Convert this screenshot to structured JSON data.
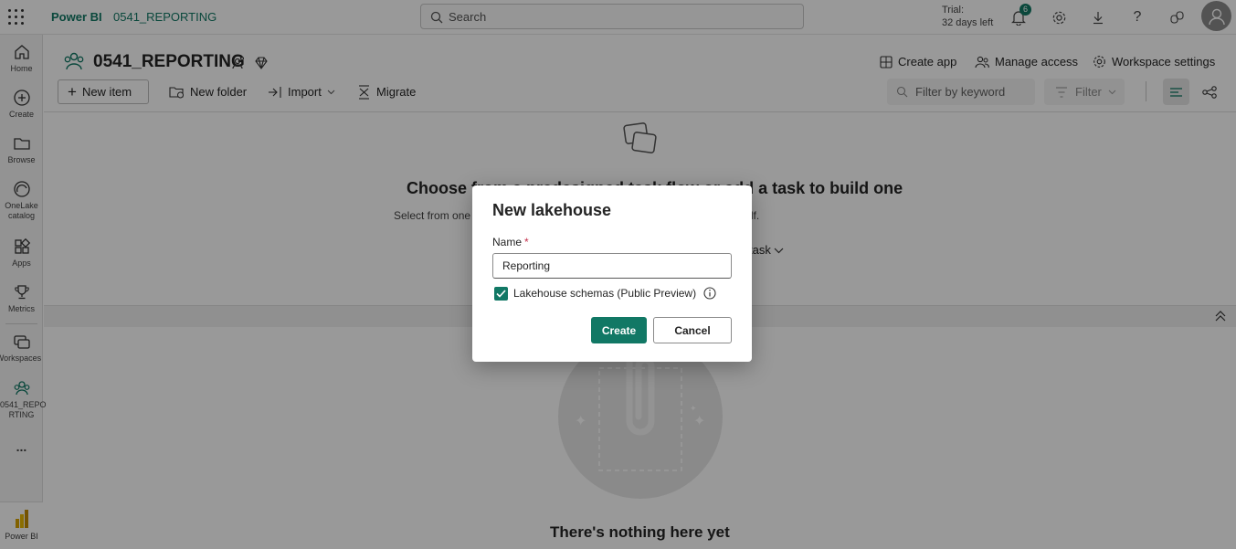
{
  "topbar": {
    "brand": "Power BI",
    "workspace_crumb": "0541_REPORTING",
    "search_placeholder": "Search",
    "trial_line1": "Trial:",
    "trial_line2": "32 days left",
    "notification_count": "6"
  },
  "rail": {
    "home": "Home",
    "create": "Create",
    "browse": "Browse",
    "onelake_1": "OneLake",
    "onelake_2": "catalog",
    "apps": "Apps",
    "metrics": "Metrics",
    "workspaces": "Workspaces",
    "current_ws_1": "0541_REPO",
    "current_ws_2": "RTING",
    "more": "...",
    "powerbi": "Power BI"
  },
  "workspace": {
    "title": "0541_REPORTING",
    "create_app": "Create app",
    "manage_access": "Manage access",
    "workspace_settings": "Workspace settings"
  },
  "toolbar": {
    "new_item": "New item",
    "new_folder": "New folder",
    "import": "Import",
    "migrate": "Migrate",
    "filter_placeholder": "Filter by keyword",
    "filter": "Filter"
  },
  "content": {
    "choose_title": "Choose from a predesigned task flow or add a task to build one",
    "choose_sub": "Select from one of the predesigned task flows or start building one yourself.",
    "task_link": "task",
    "nothing_here": "There's nothing here yet"
  },
  "dialog": {
    "title": "New lakehouse",
    "name_label": "Name",
    "required_mark": "*",
    "name_value": "Reporting",
    "schemas_checked": true,
    "schemas_label": "Lakehouse schemas (Public Preview)",
    "create": "Create",
    "cancel": "Cancel"
  },
  "colors": {
    "accent": "#117865",
    "required": "#c4314b"
  }
}
